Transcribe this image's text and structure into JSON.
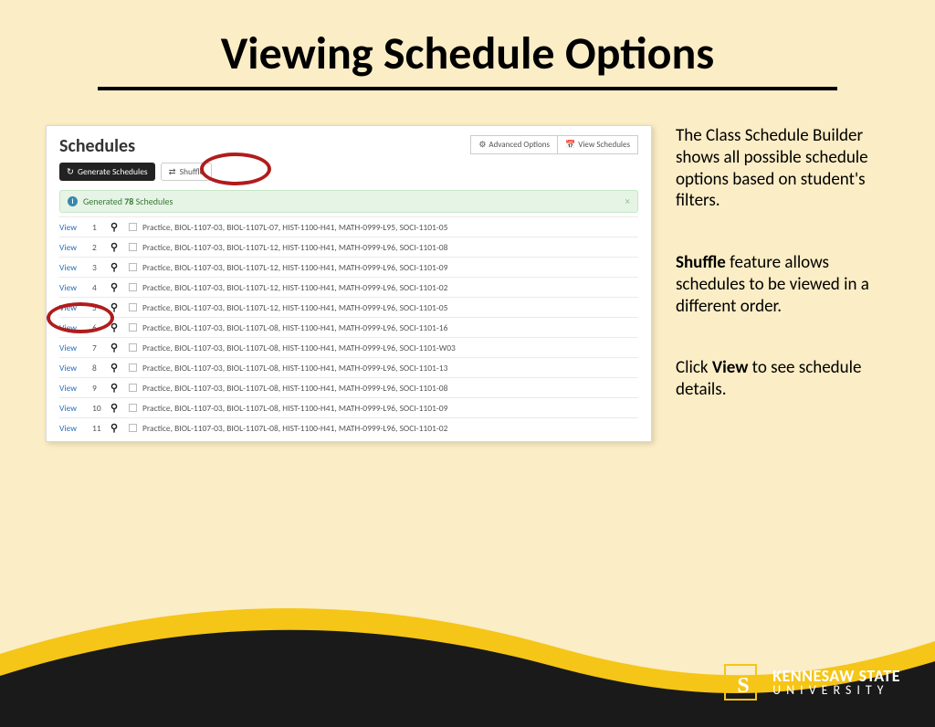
{
  "title": "Viewing Schedule Options",
  "panel": {
    "title": "Schedules",
    "tabs": {
      "advanced": "Advanced Options",
      "view": "View Schedules"
    },
    "generate_btn": "Generate Schedules",
    "shuffle_btn": "Shuffle",
    "alert_prefix": "Generated ",
    "alert_count": "78",
    "alert_suffix": " Schedules",
    "view_label": "View",
    "rows": [
      {
        "n": "1",
        "courses": "Practice, BIOL-1107-03, BIOL-1107L-07, HIST-1100-H41, MATH-0999-L95, SOCI-1101-05"
      },
      {
        "n": "2",
        "courses": "Practice, BIOL-1107-03, BIOL-1107L-12, HIST-1100-H41, MATH-0999-L96, SOCI-1101-08"
      },
      {
        "n": "3",
        "courses": "Practice, BIOL-1107-03, BIOL-1107L-12, HIST-1100-H41, MATH-0999-L96, SOCI-1101-09"
      },
      {
        "n": "4",
        "courses": "Practice, BIOL-1107-03, BIOL-1107L-12, HIST-1100-H41, MATH-0999-L96, SOCI-1101-02"
      },
      {
        "n": "5",
        "courses": "Practice, BIOL-1107-03, BIOL-1107L-12, HIST-1100-H41, MATH-0999-L96, SOCI-1101-05"
      },
      {
        "n": "6",
        "courses": "Practice, BIOL-1107-03, BIOL-1107L-08, HIST-1100-H41, MATH-0999-L96, SOCI-1101-16"
      },
      {
        "n": "7",
        "courses": "Practice, BIOL-1107-03, BIOL-1107L-08, HIST-1100-H41, MATH-0999-L96, SOCI-1101-W03"
      },
      {
        "n": "8",
        "courses": "Practice, BIOL-1107-03, BIOL-1107L-08, HIST-1100-H41, MATH-0999-L96, SOCI-1101-13"
      },
      {
        "n": "9",
        "courses": "Practice, BIOL-1107-03, BIOL-1107L-08, HIST-1100-H41, MATH-0999-L96, SOCI-1101-08"
      },
      {
        "n": "10",
        "courses": "Practice, BIOL-1107-03, BIOL-1107L-08, HIST-1100-H41, MATH-0999-L96, SOCI-1101-09"
      },
      {
        "n": "11",
        "courses": "Practice, BIOL-1107-03, BIOL-1107L-08, HIST-1100-H41, MATH-0999-L96, SOCI-1101-02"
      }
    ]
  },
  "notes": {
    "p1": "The Class Schedule Builder shows all possible schedule options based on student's filters.",
    "p2a": "Shuffle",
    "p2b": " feature allows schedules to be viewed in a different order.",
    "p3a": "Click ",
    "p3b": "View",
    "p3c": " to see schedule details."
  },
  "footer": {
    "name": "KENNESAW STATE",
    "sub": "UNIVERSITY"
  }
}
